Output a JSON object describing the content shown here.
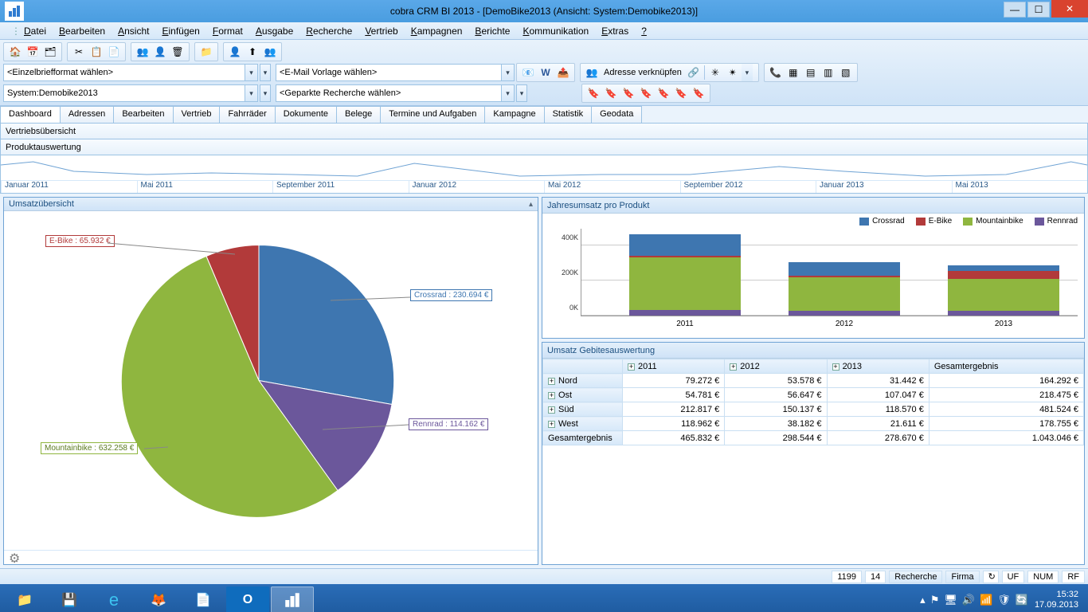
{
  "window": {
    "title": "cobra CRM BI 2013 - [DemoBike2013 (Ansicht: System:Demobike2013)]"
  },
  "menu": [
    "Datei",
    "Bearbeiten",
    "Ansicht",
    "Einfügen",
    "Format",
    "Ausgabe",
    "Recherche",
    "Vertrieb",
    "Kampagnen",
    "Berichte",
    "Kommunikation",
    "Extras",
    "?"
  ],
  "combos": {
    "brief": "<Einzelbriefformat wählen>",
    "email": "<E-Mail Vorlage wählen>",
    "view": "System:Demobike2013",
    "recherche": "<Geparkte Recherche wählen>",
    "adresse_btn": "Adresse verknüpfen"
  },
  "tabs": [
    "Dashboard",
    "Adressen",
    "Bearbeiten",
    "Vertrieb",
    "Fahrräder",
    "Dokumente",
    "Belege",
    "Termine und Aufgaben",
    "Kampagne",
    "Statistik",
    "Geodata"
  ],
  "subheaders": {
    "a": "Vertriebsübersicht",
    "b": "Produktauswertung"
  },
  "timeline_labels": [
    "Januar 2011",
    "Mai 2011",
    "September 2011",
    "Januar 2012",
    "Mai 2012",
    "September 2012",
    "Januar 2013",
    "Mai 2013"
  ],
  "panels": {
    "pie": "Umsatzübersicht",
    "bar": "Jahresumsatz pro Produkt",
    "pivot": "Umsatz Gebitesauswertung"
  },
  "colors": {
    "crossrad": "#3e76b0",
    "ebike": "#b23a3a",
    "mountain": "#8fb63f",
    "rennrad": "#6b579b"
  },
  "pie_labels": {
    "ebike": "E-Bike : 65.932 €",
    "crossrad": "Crossrad : 230.694 €",
    "rennrad": "Rennrad : 114.162 €",
    "mountain": "Mountainbike : 632.258 €"
  },
  "bar_legend": [
    "Crossrad",
    "E-Bike",
    "Mountainbike",
    "Rennrad"
  ],
  "bar_yticks": [
    "0K",
    "200K",
    "400K"
  ],
  "bar_cats": [
    "2011",
    "2012",
    "2013"
  ],
  "pivot_years": [
    "2011",
    "2012",
    "2013"
  ],
  "pivot_total_col": "Gesamtergebnis",
  "pivot_rows": [
    {
      "name": "Nord",
      "v": [
        "79.272 €",
        "53.578 €",
        "31.442 €",
        "164.292 €"
      ]
    },
    {
      "name": "Ost",
      "v": [
        "54.781 €",
        "56.647 €",
        "107.047 €",
        "218.475 €"
      ]
    },
    {
      "name": "Süd",
      "v": [
        "212.817 €",
        "150.137 €",
        "118.570 €",
        "481.524 €"
      ]
    },
    {
      "name": "West",
      "v": [
        "118.962 €",
        "38.182 €",
        "21.611 €",
        "178.755 €"
      ]
    }
  ],
  "pivot_total_row": {
    "name": "Gesamtergebnis",
    "v": [
      "465.832 €",
      "298.544 €",
      "278.670 €",
      "1.043.046 €"
    ]
  },
  "status": {
    "n1": "1199",
    "n2": "14",
    "r": "Recherche",
    "f": "Firma",
    "uf": "UF",
    "num": "NUM",
    "rf": "RF"
  },
  "tray": {
    "time": "15:32",
    "date": "17.09.2013"
  },
  "chart_data": [
    {
      "type": "pie",
      "title": "Umsatzübersicht",
      "series": [
        {
          "name": "Crossrad",
          "value": 230694,
          "label": "Crossrad : 230.694 €",
          "color": "#3e76b0"
        },
        {
          "name": "E-Bike",
          "value": 65932,
          "label": "E-Bike : 65.932 €",
          "color": "#b23a3a"
        },
        {
          "name": "Mountainbike",
          "value": 632258,
          "label": "Mountainbike : 632.258 €",
          "color": "#8fb63f"
        },
        {
          "name": "Rennrad",
          "value": 114162,
          "label": "Rennrad : 114.162 €",
          "color": "#6b579b"
        }
      ],
      "total": 1043046,
      "unit": "€"
    },
    {
      "type": "bar",
      "stacked": true,
      "title": "Jahresumsatz pro Produkt",
      "categories": [
        "2011",
        "2012",
        "2013"
      ],
      "series": [
        {
          "name": "Crossrad",
          "color": "#3e76b0",
          "values": [
            125000,
            75000,
            30000
          ]
        },
        {
          "name": "E-Bike",
          "color": "#b23a3a",
          "values": [
            10000,
            10000,
            45000
          ]
        },
        {
          "name": "Mountainbike",
          "color": "#8fb63f",
          "values": [
            300000,
            190000,
            180000
          ]
        },
        {
          "name": "Rennrad",
          "color": "#6b579b",
          "values": [
            30000,
            25000,
            25000
          ]
        }
      ],
      "ylabel": "",
      "ylim": [
        0,
        500000
      ],
      "yticks": [
        0,
        200000,
        400000
      ],
      "ytick_labels": [
        "0K",
        "200K",
        "400K"
      ],
      "note": "Stacked series values are estimated from bar segment heights; column totals ≈ 465k / 300k / 280k."
    },
    {
      "type": "table",
      "title": "Umsatz Gebitesauswertung",
      "columns": [
        "",
        "2011",
        "2012",
        "2013",
        "Gesamtergebnis"
      ],
      "rows": [
        [
          "Nord",
          79272,
          53578,
          31442,
          164292
        ],
        [
          "Ost",
          54781,
          56647,
          107047,
          218475
        ],
        [
          "Süd",
          212817,
          150137,
          118570,
          481524
        ],
        [
          "West",
          118962,
          38182,
          21611,
          178755
        ],
        [
          "Gesamtergebnis",
          465832,
          298544,
          278670,
          1043046
        ]
      ],
      "unit": "€"
    }
  ]
}
